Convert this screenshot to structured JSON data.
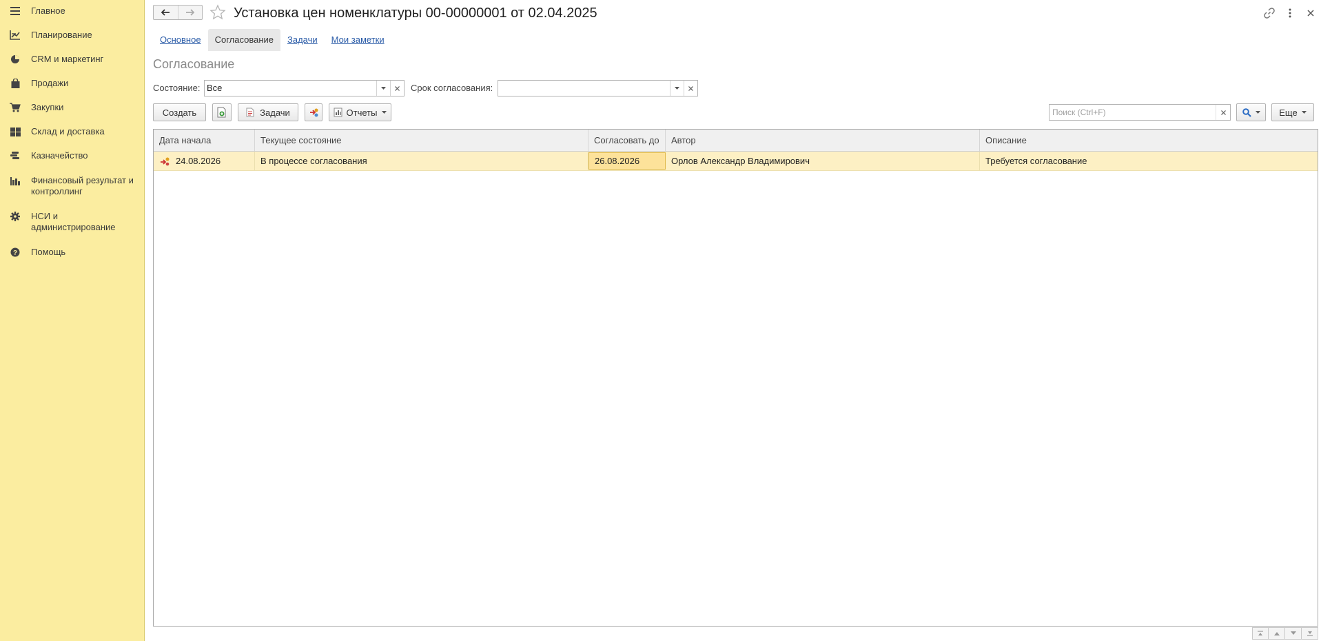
{
  "sidebar": {
    "items": [
      {
        "label": "Главное",
        "icon": "menu-icon"
      },
      {
        "label": "Планирование",
        "icon": "planning-icon"
      },
      {
        "label": "CRM и маркетинг",
        "icon": "pie-chart-icon"
      },
      {
        "label": "Продажи",
        "icon": "shopping-bag-icon"
      },
      {
        "label": "Закупки",
        "icon": "cart-icon"
      },
      {
        "label": "Склад и доставка",
        "icon": "warehouse-icon"
      },
      {
        "label": "Казначейство",
        "icon": "coins-icon"
      },
      {
        "label": "Финансовый результат и контроллинг",
        "icon": "bar-chart-icon"
      },
      {
        "label": "НСИ и администрирование",
        "icon": "gear-icon"
      },
      {
        "label": "Помощь",
        "icon": "help-icon"
      }
    ]
  },
  "header": {
    "title": "Установка цен номенклатуры 00-00000001 от 02.04.2025"
  },
  "tabs": [
    {
      "label": "Основное",
      "active": false
    },
    {
      "label": "Согласование",
      "active": true
    },
    {
      "label": "Задачи",
      "active": false
    },
    {
      "label": "Мои заметки",
      "active": false
    }
  ],
  "section_title": "Согласование",
  "filters": {
    "state_label": "Состояние:",
    "state_value": "Все",
    "deadline_label": "Срок согласования:",
    "deadline_value": ""
  },
  "toolbar": {
    "create_label": "Создать",
    "tasks_label": "Задачи",
    "reports_label": "Отчеты",
    "more_label": "Еще",
    "search_placeholder": "Поиск (Ctrl+F)"
  },
  "table": {
    "columns": [
      "Дата начала",
      "Текущее состояние",
      "Согласовать до",
      "Автор",
      "Описание"
    ],
    "rows": [
      {
        "start_date": "24.08.2026",
        "state": "В процессе согласования",
        "due_date": "26.08.2026",
        "author": "Орлов Александр Владимирович",
        "description": "Требуется согласование"
      }
    ]
  },
  "colors": {
    "sidebar_bg": "#fbeda0",
    "row_selected": "#fdf0c4",
    "cell_focus": "#fde29a",
    "link": "#2b5ca8"
  }
}
